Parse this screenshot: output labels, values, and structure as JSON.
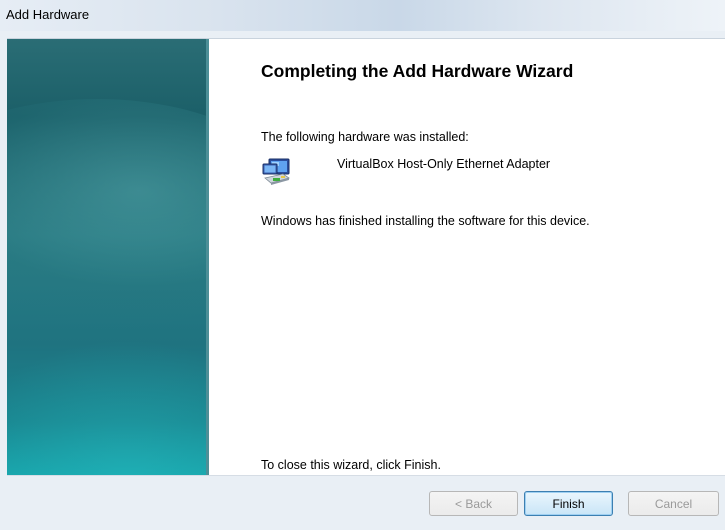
{
  "window": {
    "title": "Add Hardware"
  },
  "main": {
    "heading": "Completing the Add Hardware Wizard",
    "installed_label": "The following hardware was installed:",
    "device_name": "VirtualBox Host-Only Ethernet Adapter",
    "device_icon": "network-adapter-icon",
    "finished_message": "Windows has finished installing the software for this device.",
    "close_hint": "To close this wizard, click Finish."
  },
  "buttons": {
    "back": "< Back",
    "finish": "Finish",
    "cancel": "Cancel"
  },
  "colors": {
    "banner_top": "#1b5f68",
    "banner_bottom": "#17a2a9",
    "default_button_border": "#3c7fb1"
  }
}
